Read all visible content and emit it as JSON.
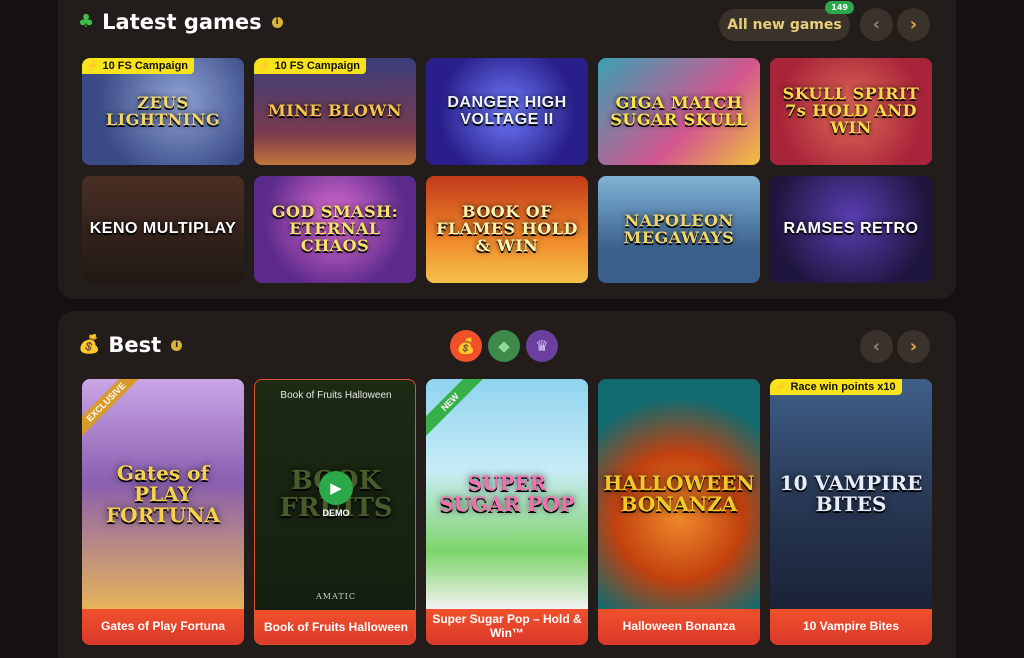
{
  "latest": {
    "icon": "clover-icon",
    "title": "Latest games",
    "all_new_label": "All new games",
    "all_new_count": "149",
    "prev": "‹",
    "next": "›",
    "games": [
      {
        "title": "ZEUS LIGHTNING",
        "tag": "10 FS Campaign"
      },
      {
        "title": "MINE BLOWN",
        "tag": "10 FS Campaign"
      },
      {
        "title": "DANGER HIGH VOLTAGE II",
        "tag": ""
      },
      {
        "title": "GIGA MATCH SUGAR SKULL",
        "tag": ""
      },
      {
        "title": "SKULL SPIRIT 7s HOLD AND WIN",
        "tag": ""
      },
      {
        "title": "KENO MULTIPLAY",
        "tag": ""
      },
      {
        "title": "GOD SMASH: ETERNAL CHAOS",
        "tag": ""
      },
      {
        "title": "BOOK OF FLAMES HOLD & WIN",
        "tag": ""
      },
      {
        "title": "NAPOLEON MEGAWAYS",
        "tag": ""
      },
      {
        "title": "RAMSES RETRO",
        "tag": ""
      }
    ]
  },
  "best": {
    "icon": "money-bag-icon",
    "title": "Best",
    "prev": "‹",
    "next": "›",
    "filters": [
      {
        "name": "money-bag-icon",
        "glyph": "💰",
        "color": "#f0512b"
      },
      {
        "name": "diamond-icon",
        "glyph": "◆",
        "color": "#3d8a4a"
      },
      {
        "name": "crown-icon",
        "glyph": "♛",
        "color": "#6a3f9e"
      }
    ],
    "games": [
      {
        "art": "Gates of PLAY FORTUNA",
        "caption": "Gates of Play Fortuna",
        "ribbon": "EXCLUSIVE"
      },
      {
        "art": "BOOK FRUITS",
        "caption": "Book of Fruits Halloween",
        "hover_title": "Book of Fruits Halloween",
        "demo": "DEMO",
        "provider": "AMATIC"
      },
      {
        "art": "SUPER SUGAR POP",
        "caption": "Super Sugar Pop – Hold & Win™",
        "ribbon": "NEW"
      },
      {
        "art": "HALLOWEEN BONANZA",
        "caption": "Halloween Bonanza"
      },
      {
        "art": "10 VAMPIRE BITES",
        "caption": "10 Vampire Bites",
        "tag": "Race win points x10"
      }
    ]
  }
}
